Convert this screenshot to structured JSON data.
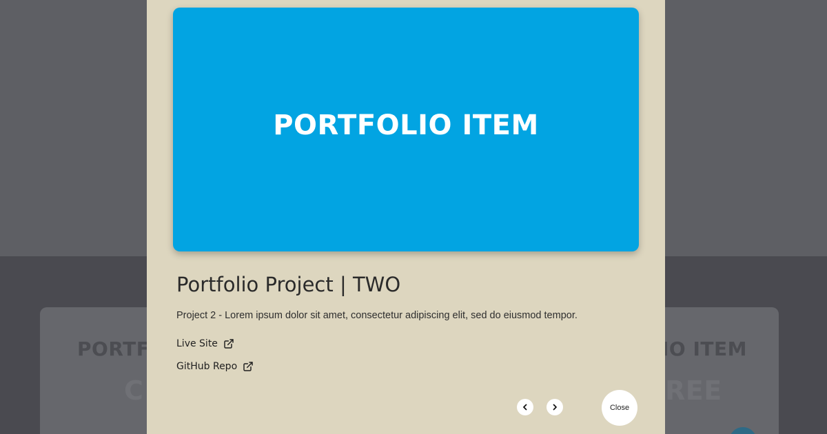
{
  "background": {
    "card_left_text": "PORTFO",
    "card_right_text": "IO ITEM",
    "card_left_subtext": "C",
    "card_right_subtext": "REE"
  },
  "modal": {
    "hero_text": "PORTFOLIO ITEM",
    "title": "Portfolio Project | TWO",
    "description": "Project 2 - Lorem ipsum dolor sit amet, consectetur adipiscing elit, sed do eiusmod tempor.",
    "links": {
      "live_site": "Live Site",
      "github_repo": "GitHub Repo"
    },
    "icons": {
      "external": "external-link-icon",
      "prev": "chevron-left-icon",
      "next": "chevron-right-icon"
    },
    "close_label": "Close"
  },
  "colors": {
    "hero_bg": "#02a4e2",
    "modal_bg": "#ddd6bf",
    "overlay_dark": "#4a4a50"
  }
}
